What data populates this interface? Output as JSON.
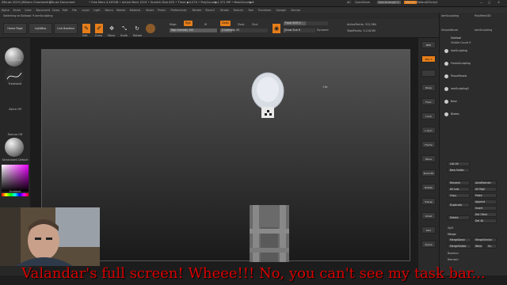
{
  "titlebar": {
    "app": "ZBrush 2019 [William Chamberlin]",
    "doc": "ZBrush Document",
    "mem": "• Free Mem 4.497GB • Active Mem 1515 • Scratch Disk 625 • Timer ▶0.074 • PolyCount▶2.371 MP • MeshCount▶6",
    "ac": "AC",
    "quicksave": "QuickSave",
    "see_through": "See-through 0",
    "menus_btn": "Menus",
    "default_script": "DefaultZScript"
  },
  "menus": [
    "Alpha",
    "Brush",
    "Color",
    "Document",
    "Draw",
    "Edit",
    "File",
    "Layer",
    "Light",
    "Macro",
    "Marker",
    "Material",
    "Movie",
    "Picker",
    "Preferences",
    "Render",
    "Stencil",
    "Stroke",
    "Texture",
    "Tool",
    "Transform",
    "Zplugin",
    "Zscript"
  ],
  "switch_label": "Switching to Subtool: 9  iamSculpting",
  "shelf": {
    "home_page": "Home Page",
    "lightbox": "LightBox",
    "live_boolean": "Live Boolean",
    "edit": "Edit",
    "draw": "Draw",
    "move": "Move",
    "scale": "Scale",
    "rotate": "Rotate",
    "mrgb": "Mrgb",
    "rgb": "Rgb",
    "m": "M",
    "rgb_intensity": "Rgb Intensity 100",
    "zadd": "Zadd",
    "zsub": "Zsub",
    "zcut": "Zcut",
    "z_intensity": "Z Intensity 25",
    "focal_shift": "Focal Shift 0",
    "draw_size": "Draw Size 6",
    "dynamic": "Dynamic",
    "active_points": "ActivePoints: 312,984",
    "total_points": "TotalPoints: 3.118 Mil"
  },
  "left": {
    "tray_top": "",
    "alpha_off": "Alpha Off",
    "texture_off": "Texture Off",
    "material": "Skinshade4 Default",
    "gradient": "Gradient",
    "brush1": "ShelfPain",
    "brush2": "FreehandI"
  },
  "righttools": [
    "BPR",
    "SPix 3",
    "",
    "Persp",
    "Floor",
    "Local",
    "L.Sym",
    "Frame",
    "Move",
    "Zoom3D",
    "Rotate",
    "Transp",
    "Ghost",
    "Solo",
    "Xpose"
  ],
  "rightpanel": {
    "brush1": "IamSculpting",
    "brush2": "PolyMesh3D",
    "brush3": "SimpleBrush",
    "brush4": "IamSculpting",
    "subtool_hdr": "Subtool",
    "visible_count": "Visible Count 9",
    "subtools": [
      "IamSculpting",
      "FrameSculpting",
      "PhonePanels",
      "iamSculpting2",
      "Base",
      "Blades"
    ],
    "list_all": "List All",
    "new_folder": "New Folder",
    "rename": "Rename",
    "auto_reorder": "AutoReorder",
    "all_low": "All Low",
    "all_high": "All High",
    "copy": "Copy",
    "paste": "Paste",
    "append": "Append",
    "duplicate": "Duplicate",
    "insert": "Insert",
    "del_other": "Del Other",
    "delete": "Delete",
    "del_all": "Del All",
    "split": "Split",
    "merge": "Merge",
    "merge_down": "MergeDown",
    "merge_similar": "MergeSimilar",
    "merge_visible": "MergeVisible",
    "weld": "Weld",
    "uv": "Uv",
    "boolean": "Boolean",
    "remesh": "Remesh"
  },
  "canvas": {
    "floating_label": "·i·ik·"
  },
  "subtitle": "Valandar's full screen! Wheee!!! No, you can't see my task bar..."
}
